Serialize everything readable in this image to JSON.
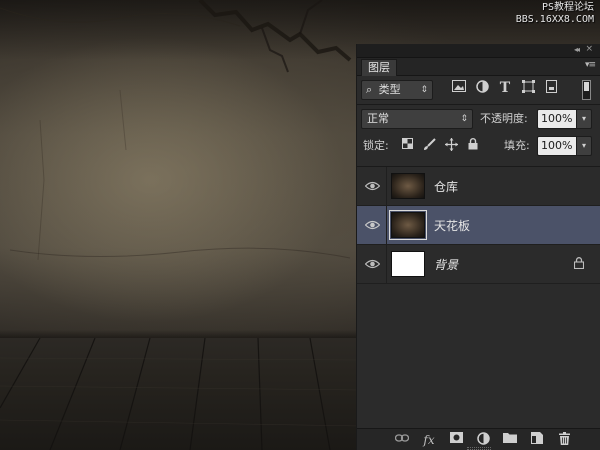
{
  "watermark": {
    "line1": "PS教程论坛",
    "line2": "BBS.16XX8.COM"
  },
  "panel": {
    "tab_label": "图层",
    "filter": {
      "kind_label": "类型",
      "search_glyph": "⌕",
      "icons": [
        "image-filter-icon",
        "adjustment-filter-icon",
        "type-filter-icon",
        "shape-filter-icon",
        "smart-object-filter-icon"
      ]
    },
    "blend": {
      "mode": "正常",
      "opacity_label": "不透明度:",
      "opacity_value": "100%"
    },
    "lock": {
      "label": "锁定:",
      "fill_label": "填充:",
      "fill_value": "100%"
    },
    "layers": [
      {
        "name": "仓库",
        "visible": true,
        "selected": false,
        "thumb": "dark",
        "locked": false
      },
      {
        "name": "天花板",
        "visible": true,
        "selected": true,
        "thumb": "dark",
        "locked": false
      },
      {
        "name": "背景",
        "visible": true,
        "selected": false,
        "thumb": "white",
        "locked": true
      }
    ],
    "bottom_icons": [
      "link-layers-icon",
      "fx-icon",
      "add-mask-icon",
      "new-adjustment-icon",
      "new-group-icon",
      "new-layer-icon",
      "delete-layer-icon"
    ],
    "fx_label": "fx"
  },
  "colors": {
    "panel_bg": "#2b2b2b",
    "selected_row": "#4b5268"
  }
}
